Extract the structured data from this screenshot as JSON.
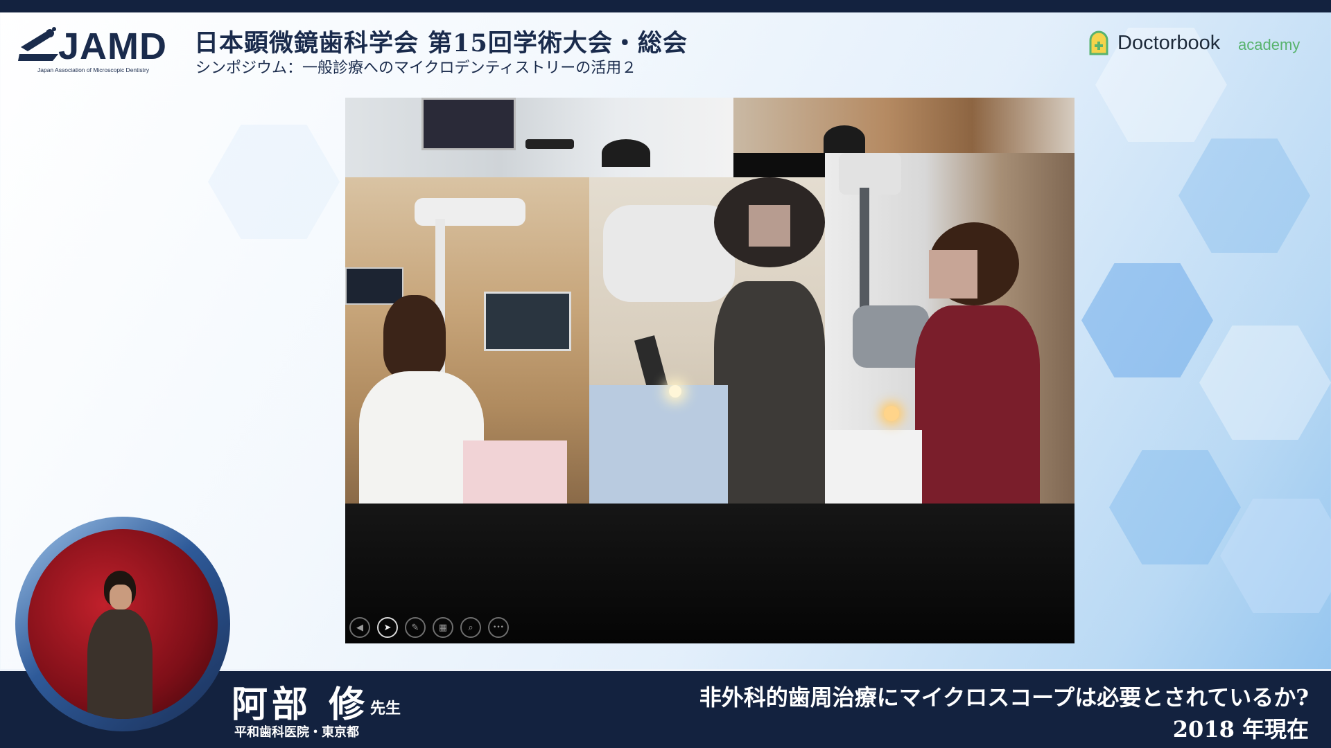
{
  "header": {
    "logo_text": "JAMD",
    "logo_subtitle": "Japan Association of Microscopic Dentistry",
    "title": "日本顕微鏡歯科学会 第15回学術大会・総会",
    "subtitle": "シンポジウム：一般診療へのマイクロデンティストリーの活用２",
    "brand_name": "Doctorbook",
    "brand_sub": "academy"
  },
  "slide": {
    "toolbar": [
      {
        "icon": "previous-icon",
        "glyph": "◀"
      },
      {
        "icon": "pointer-icon",
        "glyph": "➤"
      },
      {
        "icon": "pen-icon",
        "glyph": "✎"
      },
      {
        "icon": "slides-grid-icon",
        "glyph": "▦"
      },
      {
        "icon": "zoom-icon",
        "glyph": "⌕"
      },
      {
        "icon": "more-icon",
        "glyph": "•••"
      }
    ]
  },
  "footer": {
    "speaker_name": "阿部 修",
    "speaker_honorific": "先生",
    "speaker_affiliation": "平和歯科医院・東京都",
    "talk_title": "非外科的歯周治療にマイクロスコープは必要とされているか?",
    "talk_subtitle": "2018 年現在"
  },
  "colors": {
    "navy": "#13223f",
    "brand_green": "#58b36e"
  }
}
